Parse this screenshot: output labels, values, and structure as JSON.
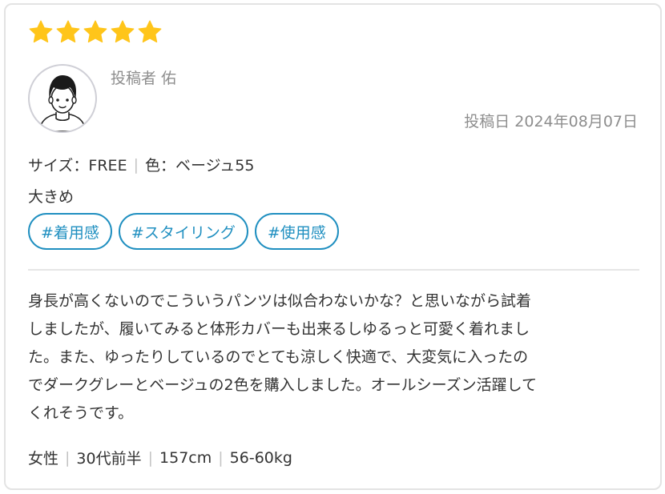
{
  "review": {
    "rating": 5,
    "rating_max": 5,
    "star_color": "#FFC51A",
    "reviewer": "投稿者 佑",
    "date": "投稿日 2024年08月07日",
    "size": "サイズ：FREE",
    "color": "色：ベージュ55",
    "fit": "大きめ",
    "tags": [
      "#着用感",
      "#スタイリング",
      "#使用感"
    ],
    "tag_color": "#1F8FC0",
    "body_lines": [
      "身長が高くないのでこういうパンツは似合わないかな？と思いながら試着",
      "しましたが、履いてみると体形カバーも出来るしゆるっと可愛く着れまし",
      "た。また、ゆったりしているのでとても涼しく快適で、大変気に入ったの",
      "でダークグレーとベージュの2色を購入しました。オールシーズン活躍して",
      "くれそうです。"
    ],
    "profile": {
      "gender": "女性",
      "age": "30代前半",
      "height": "157cm",
      "weight": "56-60kg"
    }
  },
  "icons": {
    "star": "star-icon",
    "avatar": "user-avatar-icon"
  }
}
